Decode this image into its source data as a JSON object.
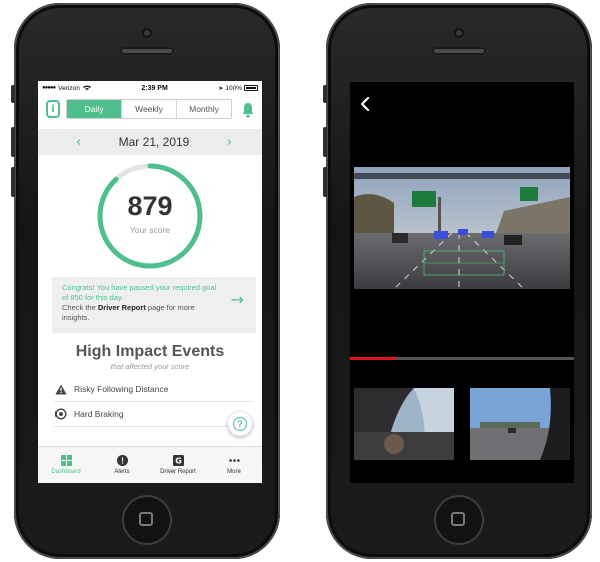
{
  "dashboard": {
    "status_bar": {
      "carrier": "Verizon",
      "time": "2:39 PM",
      "battery": "100%"
    },
    "logo_letter": "i",
    "period_tabs": [
      {
        "label": "Daily",
        "active": true
      },
      {
        "label": "Weekly",
        "active": false
      },
      {
        "label": "Monthly",
        "active": false
      }
    ],
    "date": "Mar 21, 2019",
    "score": {
      "value": "879",
      "label": "Your score",
      "ring_fill_fraction": 0.88
    },
    "congrats": {
      "line1": "Congrats! You have passed your required goal of 850 for this day.",
      "line2_prefix": "Check the",
      "line2_link": "Driver Report",
      "line2_suffix": "page for more insights."
    },
    "events": {
      "title": "High Impact Events",
      "subtitle": "that affected your score",
      "items": [
        {
          "label": "Risky Following Distance",
          "icon": "warning-icon"
        },
        {
          "label": "Hard Braking",
          "icon": "braking-icon"
        }
      ]
    },
    "tab_bar": [
      {
        "label": "Dashboard",
        "icon": "dashboard-icon",
        "active": true
      },
      {
        "label": "Alerts",
        "icon": "alert-icon",
        "active": false
      },
      {
        "label": "Driver Report",
        "icon": "driver-report-icon",
        "active": false
      },
      {
        "label": "More",
        "icon": "more-icon",
        "active": false
      }
    ]
  },
  "video_viewer": {
    "playback_progress": 0.2,
    "thumbnails": [
      {
        "name": "cabin-camera-thumbnail"
      },
      {
        "name": "road-camera-thumbnail"
      }
    ]
  },
  "colors": {
    "accent": "#4fc08d",
    "progress": "#e0141e",
    "screen_bg_dark": "#000000"
  }
}
